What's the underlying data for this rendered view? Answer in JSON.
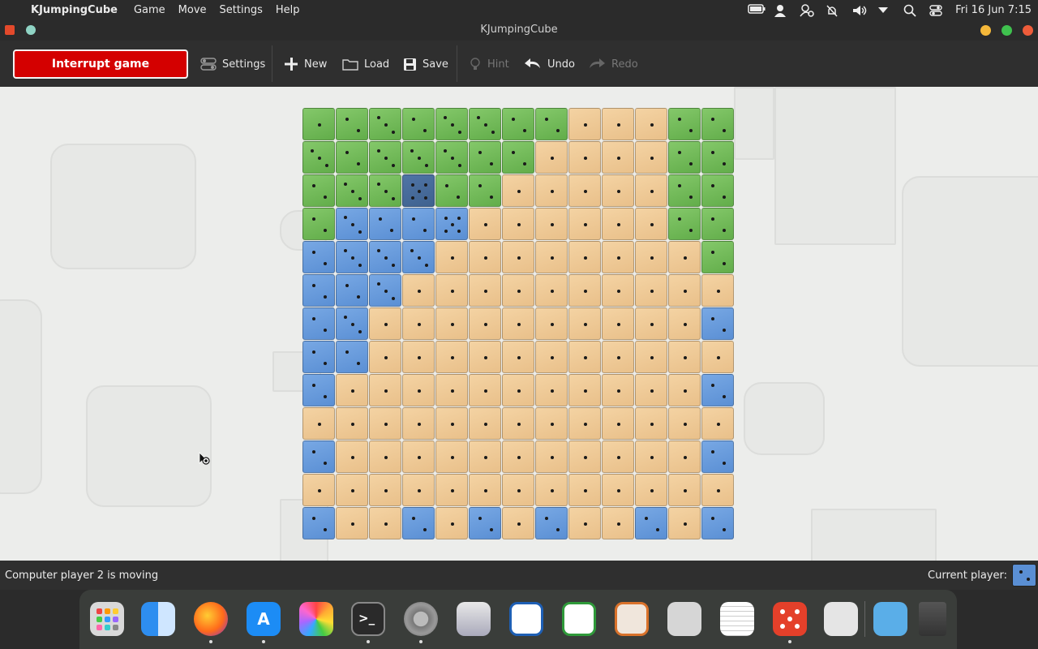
{
  "menubar": {
    "app_name": "KJumpingCube",
    "menus": [
      "Game",
      "Move",
      "Settings",
      "Help"
    ],
    "clock": "Fri 16 Jun  7:15"
  },
  "window": {
    "title": "KJumpingCube"
  },
  "toolbar": {
    "interrupt_label": "Interrupt game",
    "settings_label": "Settings",
    "new_label": "New",
    "load_label": "Load",
    "save_label": "Save",
    "hint_label": "Hint",
    "undo_label": "Undo",
    "redo_label": "Redo"
  },
  "board": {
    "size": 13,
    "legend": {
      "n": "neutral",
      "g": "green player",
      "b": "blue player",
      "s": "selected cube"
    },
    "rows": [
      "ggggggggnnngg",
      "gggggggnnnngg",
      "gggsggnnnnngg",
      "gbbbbnnnnnngg",
      "bbbbnnnnnnnng",
      "bbbnnnnnnnnnn",
      "bbnnnnnnnnnnb",
      "bbnnnnnnnnnnn",
      "bnnnnnnnnnnnb",
      "nnnnnnnnnnnnn",
      "bnnnnnnnnnnnb",
      "nnnnnnnnnnnnn",
      "bnnbnbnbnnbnb"
    ],
    "dots": [
      [
        1,
        2,
        3,
        2,
        3,
        3,
        2,
        2,
        1,
        1,
        1,
        2,
        2
      ],
      [
        3,
        2,
        3,
        3,
        3,
        2,
        2,
        1,
        1,
        1,
        1,
        2,
        2
      ],
      [
        2,
        3,
        3,
        5,
        2,
        2,
        1,
        1,
        1,
        1,
        1,
        2,
        2
      ],
      [
        2,
        3,
        2,
        2,
        5,
        1,
        1,
        1,
        1,
        1,
        1,
        2,
        2
      ],
      [
        2,
        3,
        3,
        3,
        1,
        1,
        1,
        1,
        1,
        1,
        1,
        1,
        2
      ],
      [
        2,
        2,
        3,
        1,
        1,
        1,
        1,
        1,
        1,
        1,
        1,
        1,
        1
      ],
      [
        2,
        3,
        1,
        1,
        1,
        1,
        1,
        1,
        1,
        1,
        1,
        1,
        2
      ],
      [
        2,
        2,
        1,
        1,
        1,
        1,
        1,
        1,
        1,
        1,
        1,
        1,
        1
      ],
      [
        2,
        1,
        1,
        1,
        1,
        1,
        1,
        1,
        1,
        1,
        1,
        1,
        2
      ],
      [
        1,
        1,
        1,
        1,
        1,
        1,
        1,
        1,
        1,
        1,
        1,
        1,
        1
      ],
      [
        2,
        1,
        1,
        1,
        1,
        1,
        1,
        1,
        1,
        1,
        1,
        1,
        2
      ],
      [
        1,
        1,
        1,
        1,
        1,
        1,
        1,
        1,
        1,
        1,
        1,
        1,
        1
      ],
      [
        2,
        1,
        1,
        2,
        1,
        2,
        1,
        2,
        1,
        1,
        2,
        1,
        2
      ]
    ]
  },
  "colors": {
    "interrupt_button": "#d40000",
    "green_player": "#6ab552",
    "blue_player": "#5a8fd4",
    "neutral": "#ecc58f"
  },
  "status": {
    "message": "Computer player 2 is moving",
    "current_player_label": "Current player:"
  },
  "dock": {
    "apps": [
      "launchpad",
      "finder",
      "firefox",
      "app-store",
      "photos",
      "terminal",
      "system-settings",
      "screenshot",
      "writer",
      "calc",
      "draw",
      "tape",
      "text-editor",
      "kjumpingcube",
      "calculator",
      "downloads",
      "trash"
    ]
  }
}
